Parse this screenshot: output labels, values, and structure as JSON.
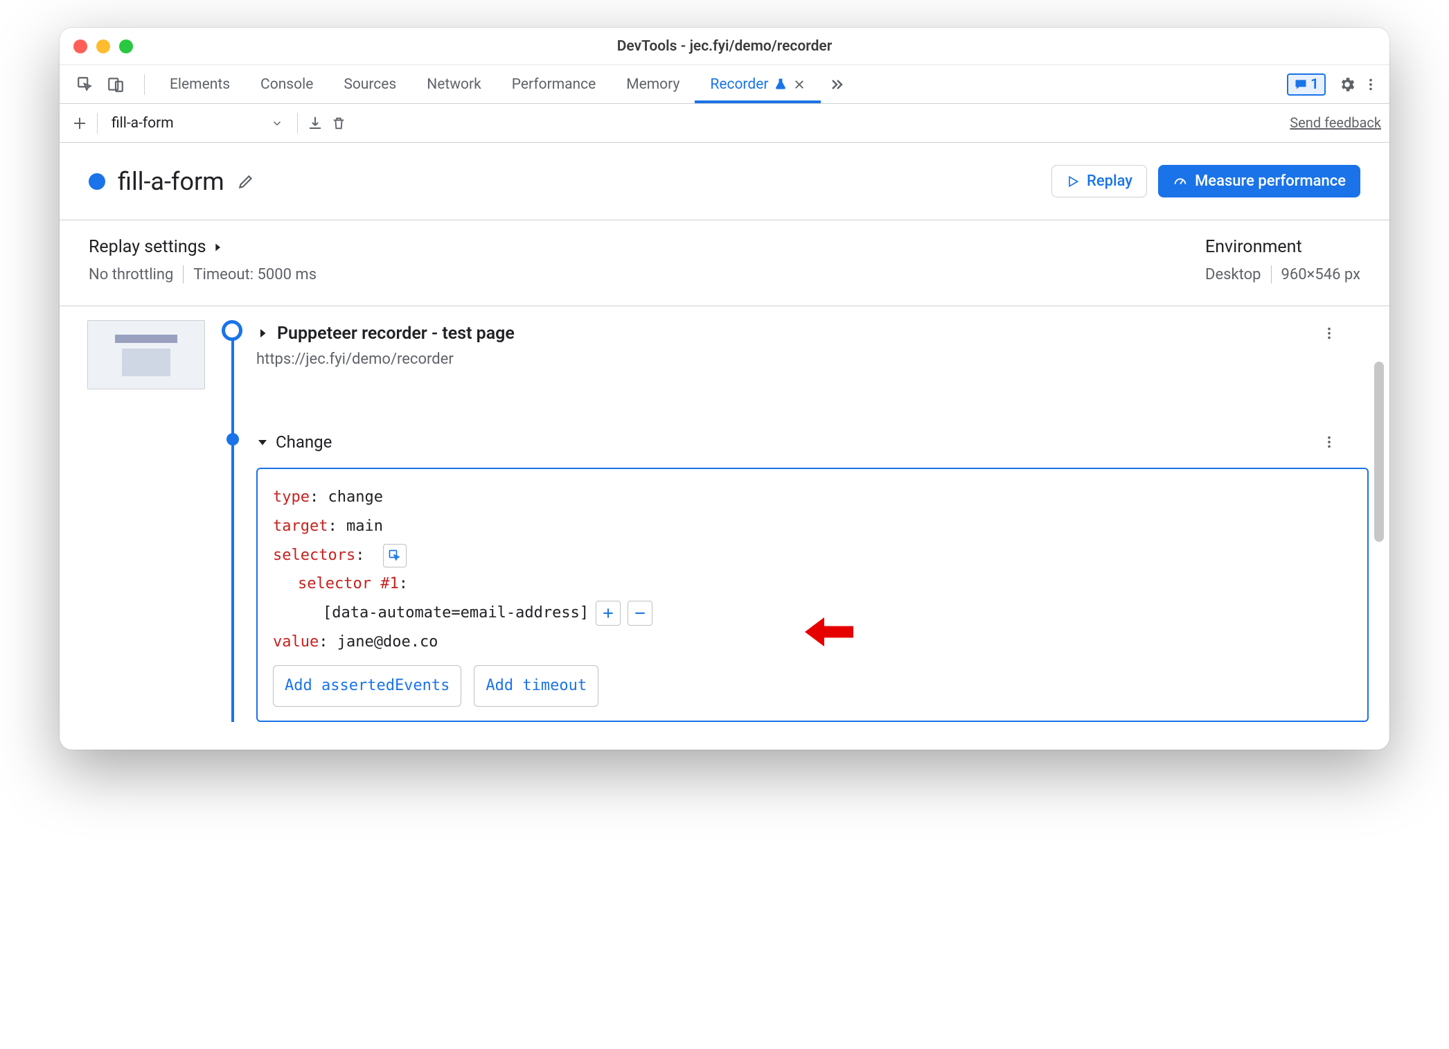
{
  "window": {
    "title": "DevTools - jec.fyi/demo/recorder"
  },
  "tabs": {
    "items": [
      "Elements",
      "Console",
      "Sources",
      "Network",
      "Performance",
      "Memory",
      "Recorder"
    ],
    "active": "Recorder",
    "badge_count": "1"
  },
  "toolbar": {
    "recording_name": "fill-a-form",
    "send_feedback": "Send feedback"
  },
  "header": {
    "title": "fill-a-form",
    "replay": "Replay",
    "measure": "Measure performance"
  },
  "settings": {
    "left_title": "Replay settings",
    "throttling": "No throttling",
    "timeout": "Timeout: 5000 ms",
    "right_title": "Environment",
    "device": "Desktop",
    "viewport": "960×546 px"
  },
  "steps": {
    "step0": {
      "title": "Puppeteer recorder - test page",
      "url": "https://jec.fyi/demo/recorder"
    },
    "step1": {
      "title": "Change",
      "details": {
        "type_key": "type",
        "type_val": "change",
        "target_key": "target",
        "target_val": "main",
        "selectors_key": "selectors",
        "selector_num_key": "selector #1",
        "selector_value": "[data-automate=email-address]",
        "value_key": "value",
        "value_val": "jane@doe.co"
      },
      "chips": {
        "asserted": "Add assertedEvents",
        "timeout": "Add timeout"
      }
    }
  }
}
